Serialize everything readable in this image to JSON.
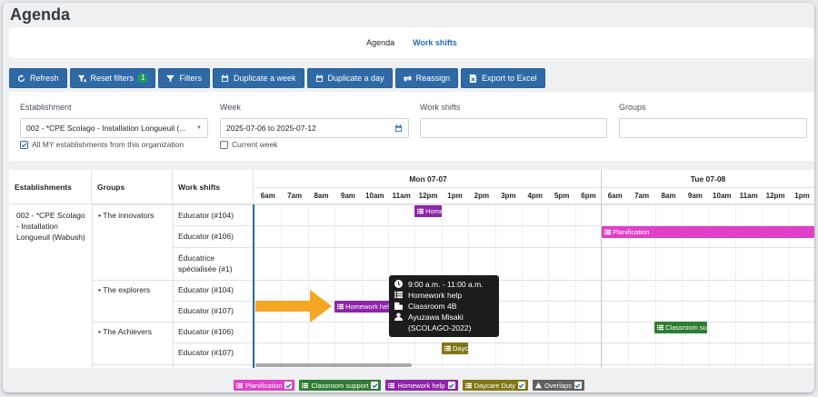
{
  "page": {
    "title": "Agenda"
  },
  "tabs": [
    {
      "label": "Agenda"
    },
    {
      "label": "Work shifts"
    }
  ],
  "toolbar": {
    "refresh": "Refresh",
    "reset_filters": "Reset filters",
    "reset_count": "1",
    "filters": "Filters",
    "duplicate_week": "Duplicate a week",
    "duplicate_day": "Duplicate a day",
    "reassign": "Reassign",
    "export": "Export to Excel"
  },
  "filters": {
    "establishment_label": "Establishment",
    "establishment_value": "002 - *CPE Scolago - Installation Longueuil (...",
    "all_my_label": "All MY establishments from this organization",
    "week_label": "Week",
    "week_value": "2025-07-06 to 2025-07-12",
    "current_week_label": "Current week",
    "work_shifts_label": "Work shifts",
    "groups_label": "Groups"
  },
  "grid": {
    "col_establishments": "Establishments",
    "col_groups": "Groups",
    "col_work_shifts": "Work shifts",
    "day1": "Mon 07-07",
    "day2": "Tue 07-08",
    "hours_day1": [
      "6am",
      "7am",
      "8am",
      "9am",
      "10am",
      "11am",
      "12pm",
      "1pm",
      "2pm",
      "3pm",
      "4pm",
      "5pm",
      "6pm"
    ],
    "hours_day2": [
      "6am",
      "7am",
      "8am",
      "9am",
      "10am",
      "11am",
      "12pm",
      "1pm"
    ],
    "establishment": "002 - *CPE Scolago - Installation Longueuil (Wabush)",
    "groups": [
      "The innovators",
      "The explorers",
      "The Achievers"
    ],
    "shifts": [
      "Educator (#104)",
      "Educator (#106)",
      "Éducatrice spécialisée (#1)",
      "Educator (#104)",
      "Educator (#107)",
      "Educator (#106)",
      "Educator (#107)"
    ],
    "events": {
      "e1": "Homework help",
      "e2": "Planification",
      "e3": "Homework help",
      "e4": "Classroom support",
      "e5": "Daycare Duty"
    }
  },
  "tooltip": {
    "time": "9:00 a.m. - 11:00 a.m.",
    "activity": "Homework help",
    "room": "Classroom 4B",
    "person": "Ayuzawa Misaki",
    "person_id": "(SCOLAGO-2022)"
  },
  "legend": [
    {
      "label": "Planification",
      "color": "#e040c8"
    },
    {
      "label": "Classroom support",
      "color": "#2e7d32"
    },
    {
      "label": "Homework help",
      "color": "#8e24aa"
    },
    {
      "label": "Daycare Duty",
      "color": "#827717"
    },
    {
      "label": "Overlaps",
      "color": "#616161"
    }
  ],
  "colors": {
    "primary": "#2f6aa7",
    "planification": "#e040c8",
    "classroom_support": "#2e7d32",
    "homework_help": "#8e24aa",
    "daycare_duty": "#827717",
    "overlaps": "#616161",
    "arrow": "#f5a623"
  }
}
